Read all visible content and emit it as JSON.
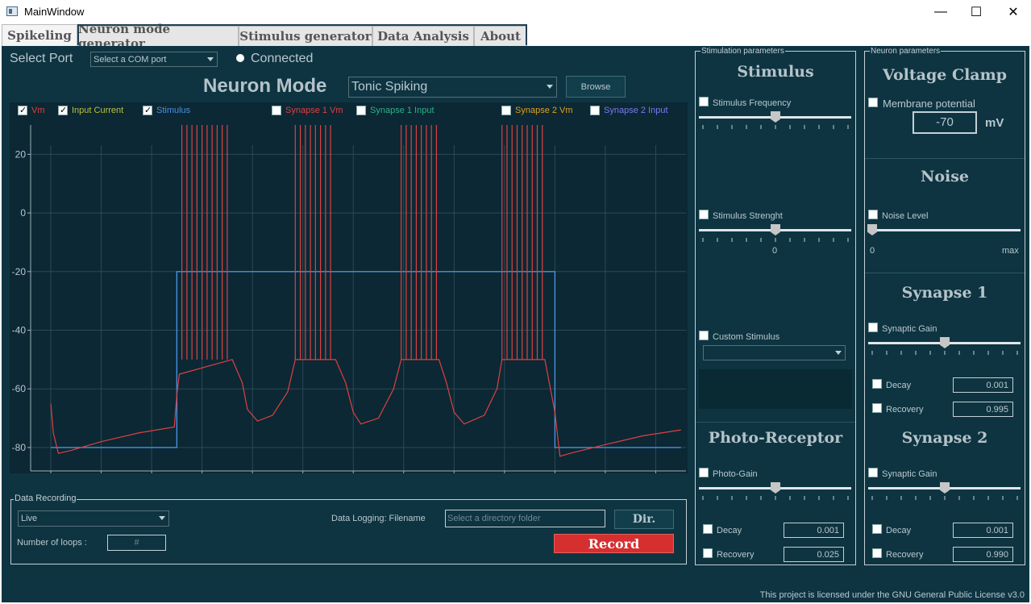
{
  "window": {
    "title": "MainWindow",
    "minimize": "—",
    "maximize": "☐",
    "close": "✕"
  },
  "tabs": [
    {
      "label": "Spikeling"
    },
    {
      "label": "Neuron mode generator"
    },
    {
      "label": "Stimulus generator"
    },
    {
      "label": "Data Analysis"
    },
    {
      "label": "About"
    }
  ],
  "port": {
    "label": "Select Port",
    "combo_value": "Select a COM port",
    "status": "Connected"
  },
  "neuron_mode": {
    "label": "Neuron Mode",
    "value": "Tonic Spiking",
    "browse": "Browse"
  },
  "legend": [
    {
      "label": "Vm",
      "checked": true,
      "color": "#e04040"
    },
    {
      "label": "Input Current",
      "checked": true,
      "color": "#b8c23a"
    },
    {
      "label": "Stimulus",
      "checked": true,
      "color": "#4a90e0"
    },
    {
      "label": "Synapse 1 Vm",
      "checked": false,
      "color": "#e04040"
    },
    {
      "label": "Synapse 1 Input",
      "checked": false,
      "color": "#2fb08a"
    },
    {
      "label": "Synapse 2 Vm",
      "checked": false,
      "color": "#e0a020"
    },
    {
      "label": "Synapse 2 Input",
      "checked": false,
      "color": "#7a7af0"
    }
  ],
  "chart_data": {
    "type": "line",
    "xlim": [
      -8,
      252
    ],
    "ylim": [
      -88,
      30
    ],
    "x_ticks": [
      "0",
      "20",
      "40",
      "60",
      "80",
      "100",
      "120",
      "140",
      "160",
      "180",
      "200",
      "220",
      "240"
    ],
    "y_ticks": [
      "20",
      "0",
      "-20",
      "-40",
      "-60",
      "-80"
    ],
    "grid": true,
    "series": [
      {
        "name": "Stimulus",
        "color": "#4a90e0",
        "points": [
          [
            0,
            -80
          ],
          [
            50,
            -80
          ],
          [
            50,
            -20
          ],
          [
            200,
            -20
          ],
          [
            200,
            -80
          ],
          [
            250,
            -80
          ]
        ]
      },
      {
        "name": "Vm",
        "color": "#e04040",
        "burst_times": [
          52,
          54,
          56,
          58,
          60,
          62,
          64,
          66,
          68,
          70,
          97,
          99,
          101,
          103,
          105,
          107,
          109,
          111,
          139,
          141,
          143,
          145,
          147,
          149,
          151,
          153,
          179,
          181,
          183,
          185,
          187,
          189,
          191,
          193,
          195
        ],
        "points": [
          [
            0,
            -65
          ],
          [
            1,
            -75
          ],
          [
            3,
            -82
          ],
          [
            8,
            -81
          ],
          [
            20,
            -78
          ],
          [
            35,
            -75
          ],
          [
            49,
            -73
          ],
          [
            50,
            -62
          ],
          [
            51,
            -55
          ],
          [
            72,
            -50
          ],
          [
            76,
            -58
          ],
          [
            78,
            -67
          ],
          [
            82,
            -71
          ],
          [
            88,
            -69
          ],
          [
            94,
            -61
          ],
          [
            97,
            -50
          ],
          [
            113,
            -50
          ],
          [
            117,
            -58
          ],
          [
            120,
            -68
          ],
          [
            123,
            -72
          ],
          [
            130,
            -70
          ],
          [
            136,
            -60
          ],
          [
            139,
            -50
          ],
          [
            154,
            -50
          ],
          [
            157,
            -58
          ],
          [
            160,
            -68
          ],
          [
            164,
            -72
          ],
          [
            172,
            -69
          ],
          [
            177,
            -60
          ],
          [
            179,
            -50
          ],
          [
            196,
            -50
          ],
          [
            200,
            -68
          ],
          [
            202,
            -83
          ],
          [
            206,
            -82
          ],
          [
            220,
            -79
          ],
          [
            235,
            -76
          ],
          [
            250,
            -74
          ]
        ]
      }
    ]
  },
  "data_recording": {
    "title": "Data Recording",
    "mode": "Live",
    "filename_label": "Data Logging: Filename",
    "filename_placeholder": "Select a directory folder",
    "dir": "Dir.",
    "loops_label": "Number of loops :",
    "loops_value": "#",
    "record": "Record"
  },
  "stim_params": {
    "title": "Stimulation parameters",
    "stimulus_title": "Stimulus",
    "frequency_label": "Stimulus Frequency",
    "strength_label": "Stimulus Strenght",
    "strength_tick": "0",
    "custom_label": "Custom Stimulus",
    "photo_title": "Photo-Receptor",
    "photo_gain_label": "Photo-Gain",
    "decay_label": "Decay",
    "decay_value": "0.001",
    "recovery_label": "Recovery",
    "recovery_value": "0.025"
  },
  "neuron_params": {
    "title": "Neuron parameters",
    "vclamp_title": "Voltage Clamp",
    "membrane_label": "Membrane potential",
    "membrane_value": "-70",
    "membrane_unit": "mV",
    "noise_title": "Noise",
    "noise_label": "Noise Level",
    "noise_min": "0",
    "noise_max": "max",
    "syn1_title": "Synapse 1",
    "syn1_gain": "Synaptic Gain",
    "syn1_decay_label": "Decay",
    "syn1_decay_value": "0.001",
    "syn1_recovery_label": "Recovery",
    "syn1_recovery_value": "0.995",
    "syn2_title": "Synapse 2",
    "syn2_gain": "Synaptic Gain",
    "syn2_decay_label": "Decay",
    "syn2_decay_value": "0.001",
    "syn2_recovery_label": "Recovery",
    "syn2_recovery_value": "0.990"
  },
  "license": "This project is licensed under the GNU General Public License v3.0"
}
